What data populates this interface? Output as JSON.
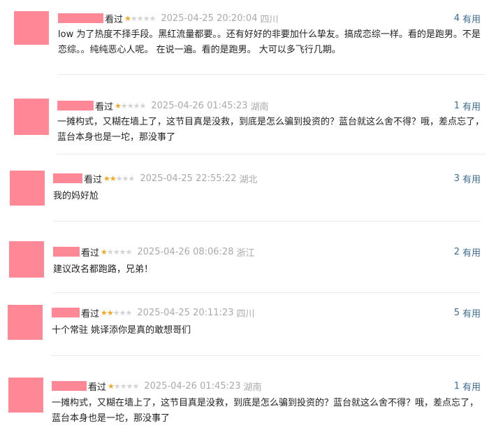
{
  "reviews": [
    {
      "action": "看过",
      "rating": 1,
      "time": "2025-04-25 20:20:04",
      "location": "四川",
      "useful_count": "4",
      "useful_label": "有用",
      "content": "low 为了热度不择手段。黑红流量都要。。还有好好的非要加什么挚友。搞成恋综一样。看的是跑男。不是恋综。。纯纯恶心人呢。 在说一遍。看的是跑男。 大可以多飞行几期。"
    },
    {
      "action": "看过",
      "rating": 1,
      "time": "2025-04-26 01:45:23",
      "location": "湖南",
      "useful_count": "1",
      "useful_label": "有用",
      "content": "一摊构式，又糊在墙上了，这节目真是没救，到底是怎么骗到投资的？蓝台就这么舍不得？哦，差点忘了，蓝台本身也是一坨，那没事了"
    },
    {
      "action": "看过",
      "rating": 2,
      "time": "2025-04-25 22:55:22",
      "location": "湖北",
      "useful_count": "3",
      "useful_label": "有用",
      "content": "我的妈好尬"
    },
    {
      "action": "看过",
      "rating": 1,
      "time": "2025-04-26 08:06:28",
      "location": "浙江",
      "useful_count": "2",
      "useful_label": "有用",
      "content": "建议改名都跑路，兄弟！"
    },
    {
      "action": "看过",
      "rating": 2,
      "time": "2025-04-25 20:11:23",
      "location": "四川",
      "useful_count": "5",
      "useful_label": "有用",
      "content": "十个常驻 姚译添你是真的敢想哥们"
    },
    {
      "action": "看过",
      "rating": 1,
      "time": "2025-04-26 01:45:23",
      "location": "湖南",
      "useful_count": "1",
      "useful_label": "有用",
      "content": "一摊构式，又糊在墙上了，这节目真是没救，到底是怎么骗到投资的？蓝台就这么舍不得？哦，差点忘了，蓝台本身也是一坨，那没事了"
    }
  ],
  "colors": {
    "star_on": "#f5a623",
    "star_off": "#d3d3d3",
    "useful": "#3b6d96",
    "avatar_mask": "#ff8896"
  }
}
